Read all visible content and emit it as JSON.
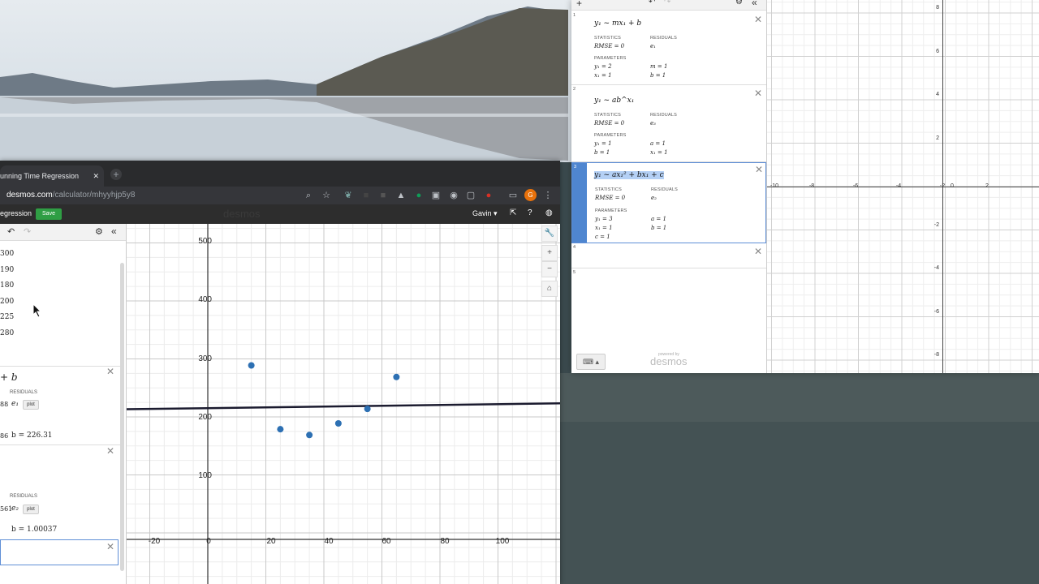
{
  "browser": {
    "tab_title": "unning Time Regression",
    "new_tab": "+",
    "close": "✕",
    "url_domain": "desmos.com",
    "url_path": "/calculator/mhyyhjp5y8",
    "profile_initial": "G"
  },
  "desmos_header": {
    "title_partial": "egression",
    "save_label": "Save",
    "logo": "desmos",
    "user": "Gavin ▾"
  },
  "expressions": {
    "table_values": [
      "300",
      "190",
      "180",
      "200",
      "225",
      "280"
    ],
    "expr1": {
      "formula_tail": "+ b",
      "residuals_label": "RESIDUALS",
      "rmse_tail": "88",
      "residual_var": "e₁",
      "plot_label": "plot",
      "m_tail": "86",
      "b_value": "b = 226.31"
    },
    "expr2": {
      "residuals_label": "RESIDUALS",
      "rmse_tail": "561",
      "residual_var": "e₂",
      "plot_label": "plot",
      "b_value": "b = 1.00037"
    }
  },
  "graph": {
    "y_ticks": [
      "500",
      "400",
      "300",
      "200",
      "100"
    ],
    "x_ticks": [
      "-20",
      "0",
      "20",
      "40",
      "60",
      "80",
      "100"
    ]
  },
  "chart_data": {
    "type": "scatter",
    "x": [
      15,
      25,
      35,
      45,
      55,
      65
    ],
    "y": [
      300,
      190,
      180,
      200,
      225,
      280
    ],
    "regression_line": {
      "m": 0.0686,
      "b": 226.31
    },
    "xlim": [
      -28,
      122
    ],
    "ylim": [
      -40,
      530
    ],
    "grid": true
  },
  "popup": {
    "expr1": {
      "index": "1",
      "formula": "y₁ ~ mx₁ + b",
      "statistics_label": "STATISTICS",
      "residuals_label": "RESIDUALS",
      "rmse": "RMSE = 0",
      "residual": "e₁",
      "parameters_label": "PARAMETERS",
      "p1": "y₁ = 2",
      "p2": "x₁ = 1",
      "p3": "m = 1",
      "p4": "b = 1"
    },
    "expr2": {
      "index": "2",
      "formula": "y₁ ~ ab^x₁",
      "statistics_label": "STATISTICS",
      "residuals_label": "RESIDUALS",
      "rmse": "RMSE = 0",
      "residual": "e₃",
      "parameters_label": "PARAMETERS",
      "p1": "y₁ = 1",
      "p2": "b = 1",
      "p3": "a = 1",
      "p4": "x₁ = 1"
    },
    "expr3": {
      "index": "3",
      "formula": "y₁ ~ ax₁² + bx₁ + c",
      "statistics_label": "STATISTICS",
      "residuals_label": "RESIDUALS",
      "rmse": "RMSE = 0",
      "residual": "e₂",
      "parameters_label": "PARAMETERS",
      "p1": "y₁ = 3",
      "p2": "x₁ = 1",
      "p3": "c = 1",
      "p4": "a = 1",
      "p5": "b = 1"
    },
    "expr4_index": "4",
    "expr5_index": "5",
    "powered_by": "powered by",
    "logo": "desmos",
    "y_ticks": [
      "8",
      "6",
      "4",
      "2",
      "-2",
      "-4",
      "-6",
      "-8"
    ],
    "x_ticks": [
      "-10",
      "-8",
      "-6",
      "-4",
      "-2",
      "0",
      "2"
    ]
  }
}
